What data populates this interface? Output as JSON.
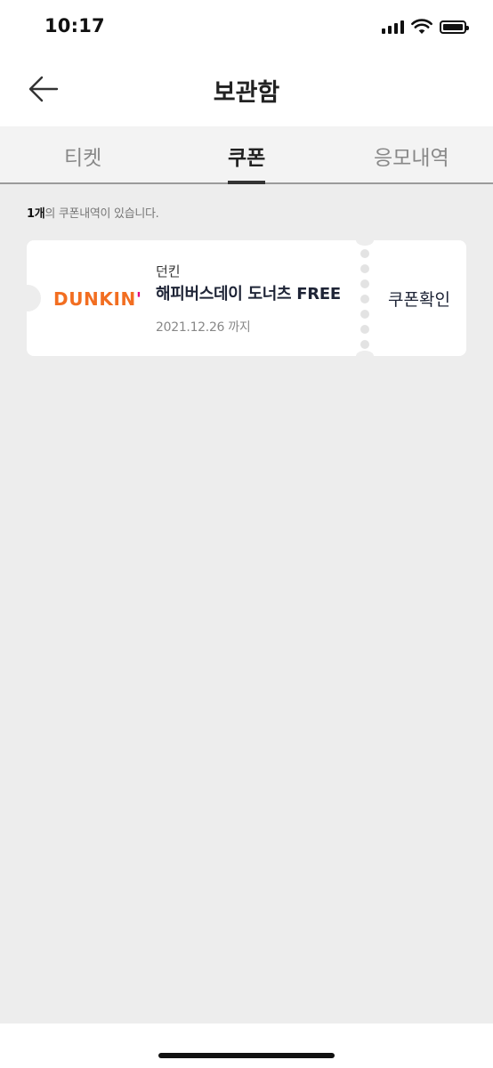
{
  "status_bar": {
    "time": "10:17"
  },
  "header": {
    "title": "보관함",
    "back_icon": "arrow-left-icon"
  },
  "tabs": [
    {
      "label": "티켓",
      "active": false
    },
    {
      "label": "쿠폰",
      "active": true
    },
    {
      "label": "응모내역",
      "active": false
    }
  ],
  "summary": {
    "count": "1개",
    "suffix": "의 쿠폰내역이 있습니다."
  },
  "coupons": [
    {
      "logo_text": "DUNKIN",
      "logo_mark": "'",
      "brand": "던킨",
      "title": "해피버스데이 도너츠 FREE",
      "expiry": "2021.12.26 까지",
      "action_label": "쿠폰확인"
    }
  ],
  "colors": {
    "dunkin_orange": "#f26e21",
    "dunkin_pink": "#e5007d",
    "background": "#ededed"
  }
}
